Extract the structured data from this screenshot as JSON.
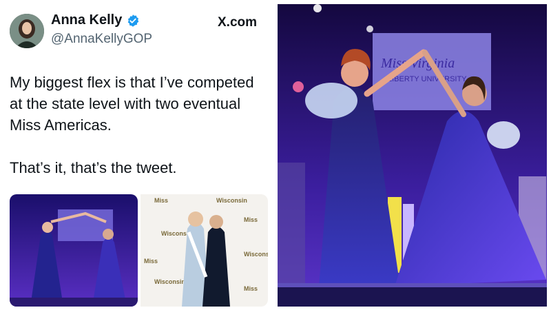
{
  "tweet": {
    "display_name": "Anna Kelly",
    "handle": "@AnnaKellyGOP",
    "brand": "X.com",
    "verified_icon": "verified-badge-icon",
    "paragraphs": [
      "My biggest flex is that I’ve competed at the state level with two eventual Miss Americas.",
      "That’s it, that’s the tweet."
    ]
  },
  "photos": {
    "stage_banner": [
      "Miss Virginia",
      "LIBERTY UNIVERSITY"
    ],
    "backdrop_logo": [
      "Miss",
      "Wisconsin"
    ]
  },
  "colors": {
    "text": "#0f1419",
    "secondary": "#536471",
    "verified": "#1d9bf0",
    "stage_purple": "#3b1e9e",
    "gown_blue": "#2a2a9a"
  }
}
